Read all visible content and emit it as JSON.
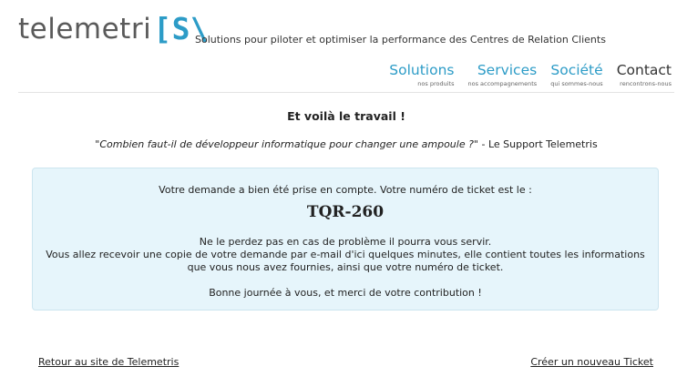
{
  "header": {
    "logo_main": "telemetri",
    "logo_bracket": "[S\\",
    "tagline": "Solutions pour piloter et optimiser la performance des Centres de Relation Clients"
  },
  "nav": [
    {
      "label": "Solutions",
      "sub": "nos produits"
    },
    {
      "label": "Services",
      "sub": "nos accompagnements"
    },
    {
      "label": "Société",
      "sub": "qui sommes-nous"
    },
    {
      "label": "Contact",
      "sub": "rencontrons-nous"
    }
  ],
  "main": {
    "title": "Et voilà le travail !",
    "quote": "\"Combien faut-il de développeur informatique pour changer une ampoule ?\"",
    "quote_author": " - Le Support Telemetris"
  },
  "confirmation": {
    "intro": "Votre demande a bien été prise en compte. Votre numéro de ticket est le :",
    "ticket": "TQR-260",
    "line1": "Ne le perdez pas en cas de problème il pourra vous servir.",
    "line2": "Vous allez recevoir une copie de votre demande par e-mail d'ici quelques minutes, elle contient toutes les informations",
    "line3": "que vous nous avez fournies, ainsi que votre numéro de ticket.",
    "thanks": "Bonne journée à vous, et merci de votre contribution !"
  },
  "footer": {
    "back_link": "Retour au site de Telemetris",
    "new_ticket_link": "Créer un nouveau Ticket"
  }
}
